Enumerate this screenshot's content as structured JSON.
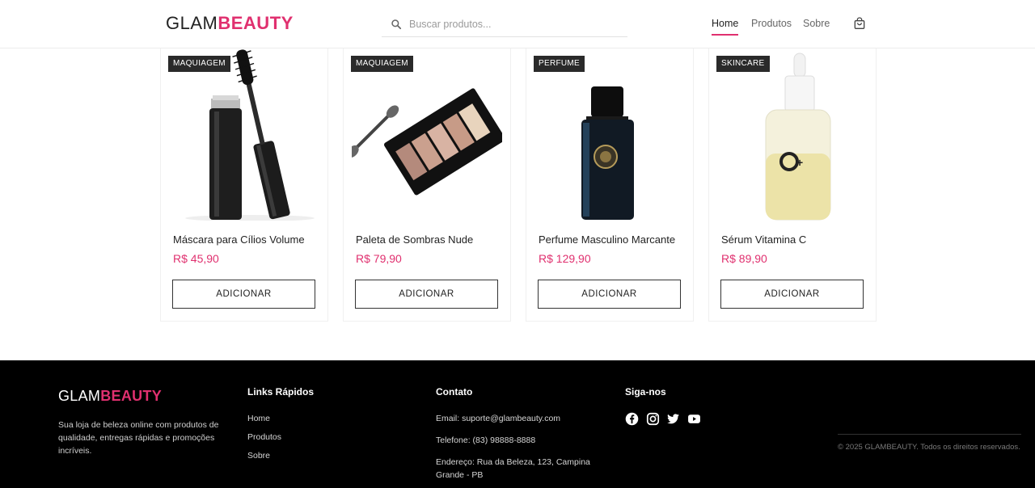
{
  "header": {
    "logo_part1": "GLAM",
    "logo_part2": "BEAUTY",
    "search_placeholder": "Buscar produtos...",
    "nav": [
      "Home",
      "Produtos",
      "Sobre"
    ],
    "active_nav": "Home",
    "icons": {
      "search": "search-icon",
      "cart": "shopping-bag-icon"
    }
  },
  "products": [
    {
      "category": "MAQUIAGEM",
      "name": "Máscara para Cílios Volume",
      "price": "R$ 45,90",
      "button": "ADICIONAR",
      "image": "mascara-wand"
    },
    {
      "category": "MAQUIAGEM",
      "name": "Paleta de Sombras Nude",
      "price": "R$ 79,90",
      "button": "ADICIONAR",
      "image": "eyeshadow-palette"
    },
    {
      "category": "PERFUME",
      "name": "Perfume Masculino Marcante",
      "price": "R$ 129,90",
      "button": "ADICIONAR",
      "image": "perfume-bottle"
    },
    {
      "category": "SKINCARE",
      "name": "Sérum Vitamina C",
      "price": "R$ 89,90",
      "button": "ADICIONAR",
      "image": "serum-dropper-bottle"
    }
  ],
  "footer": {
    "logo_part1": "GLAM",
    "logo_part2": "BEAUTY",
    "description": "Sua loja de beleza online com produtos de qualidade, entregas rápidas e promoções incríveis.",
    "links_title": "Links Rápidos",
    "links": [
      "Home",
      "Produtos",
      "Sobre"
    ],
    "contact_title": "Contato",
    "email": "Email: suporte@glambeauty.com",
    "phone": "Telefone: (83) 98888-8888",
    "address": "Endereço: Rua da Beleza, 123, Campina Grande - PB",
    "social_title": "Siga-nos",
    "social": [
      "facebook-icon",
      "instagram-icon",
      "twitter-icon",
      "youtube-icon"
    ],
    "copyright": "© 2025 GLAMBEAUTY. Todos os direitos reservados."
  },
  "colors": {
    "accent": "#e0306f",
    "footer_bg": "#000000",
    "badge_bg": "#2a2a2a"
  }
}
